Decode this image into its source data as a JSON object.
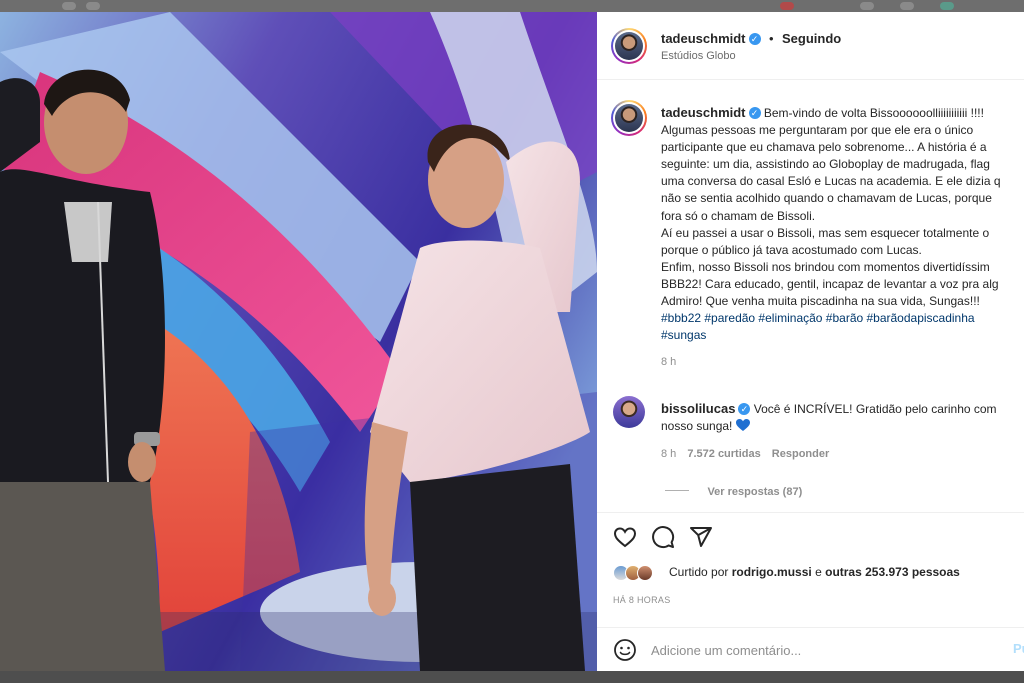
{
  "colors": {
    "accent": "#3897f0",
    "hashtag": "#00376b",
    "muted": "#8e8e8e",
    "heart_emoji": "#1f6fd1"
  },
  "post": {
    "author": "tadeuschmidt",
    "follow_status": "Seguindo",
    "location": "Estúdios Globo",
    "caption_lines": [
      "Bem-vindo de volta Bissoooooolliiiiiiiiiii !!!!",
      "Algumas pessoas me perguntaram por que ele era o único",
      "participante que eu chamava pelo sobrenome... A história é a",
      "seguinte: um dia, assistindo ao Globoplay de madrugada, flag",
      "uma conversa do casal Esló e Lucas na academia. E ele dizia q",
      "não se sentia acolhido quando o chamavam de Lucas, porque",
      "fora só o chamam de Bissoli.",
      "Aí eu passei a usar o Bissoli, mas sem esquecer totalmente o",
      "porque o público já tava acostumado com Lucas.",
      "Enfim, nosso Bissoli nos brindou com momentos divertidíssim",
      "BBB22! Cara educado, gentil, incapaz de levantar a voz pra alg",
      "Admiro! Que venha muita piscadinha na sua vida, Sungas!!!"
    ],
    "hashtags_line1": "#bbb22 #paredão #eliminação #barão #barãodapiscadinha",
    "hashtags_line2": "#sungas",
    "caption_age": "8 h"
  },
  "comment": {
    "author": "bissolilucas",
    "text_line1": "Você é INCRÍVEL! Gratidão pelo carinho com",
    "text_line2": "nosso sunga!",
    "age": "8 h",
    "likes": "7.572 curtidas",
    "reply": "Responder",
    "view_replies": "Ver respostas (87)"
  },
  "likes": {
    "prefix": "Curtido por",
    "user": "rodrigo.mussi",
    "middle": "e",
    "others": "outras 253.973 pessoas"
  },
  "timestamp": "HÁ 8 HORAS",
  "comment_box": {
    "placeholder": "Adicione um comentário...",
    "post_label": "Publicar"
  },
  "icons": [
    "verified-badge",
    "heart-icon",
    "comment-icon",
    "share-icon",
    "emoji-icon",
    "blue-heart-emoji"
  ]
}
